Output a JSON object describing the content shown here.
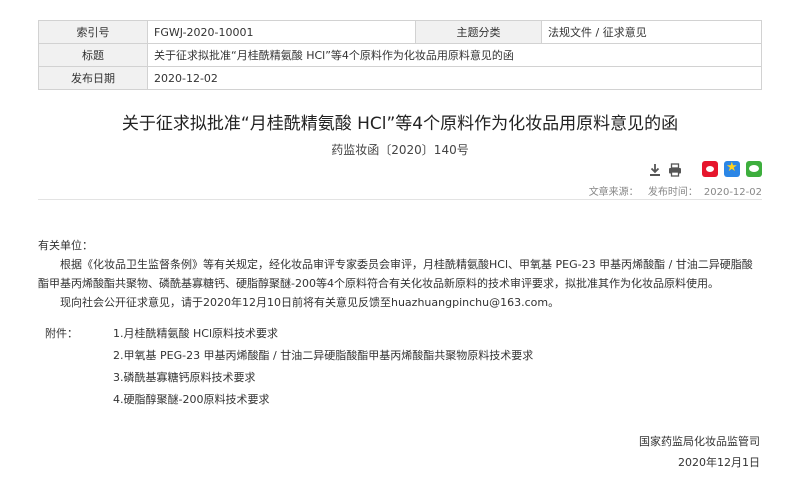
{
  "meta": {
    "index_label": "索引号",
    "index_value": "FGWJ-2020-10001",
    "category_label": "主题分类",
    "category_value": "法规文件 / 征求意见",
    "title_label": "标题",
    "title_value": "关于征求拟批准“月桂酰精氨酸 HCl”等4个原料作为化妆品用原料意见的函",
    "date_label": "发布日期",
    "date_value": "2020-12-02"
  },
  "article": {
    "title": "关于征求拟批准“月桂酰精氨酸 HCl”等4个原料作为化妆品用原料意见的函",
    "doc_number": "药监妆函〔2020〕140号",
    "source_label": "文章来源：",
    "publish_label": "发布时间：",
    "publish_date": "2020-12-02",
    "icons": [
      "download-icon",
      "print-icon",
      "weibo-icon",
      "qzone-icon",
      "wechat-icon"
    ]
  },
  "body": {
    "salutation": "有关单位：",
    "para1": "根据《化妆品卫生监督条例》等有关规定，经化妆品审评专家委员会审评，月桂酰精氨酸HCl、甲氧基 PEG-23 甲基丙烯酸酯 / 甘油二异硬脂酸酯甲基丙烯酸酯共聚物、磷酰基寡糖钙、硬脂醇聚醚-200等4个原料符合有关化妆品新原料的技术审评要求，拟批准其作为化妆品原料使用。",
    "para2": "现向社会公开征求意见，请于2020年12月10日前将有关意见反馈至huazhuangpinchu@163.com。",
    "attachments_label": "附件：",
    "attachments": [
      "1.月桂酰精氨酸 HCl原料技术要求",
      "2.甲氧基 PEG-23 甲基丙烯酸酯 / 甘油二异硬脂酸酯甲基丙烯酸酯共聚物原料技术要求",
      "3.磷酰基寡糖钙原料技术要求",
      "4.硬脂醇聚醚-200原料技术要求"
    ]
  },
  "signature": {
    "org": "国家药监局化妆品监管司",
    "date": "2020年12月1日"
  }
}
